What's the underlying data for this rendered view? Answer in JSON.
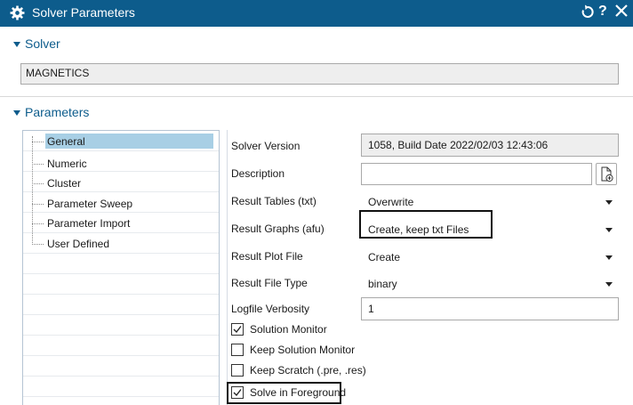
{
  "window": {
    "title": "Solver Parameters",
    "help_label": "?"
  },
  "sections": {
    "solver_heading": "Solver",
    "parameters_heading": "Parameters"
  },
  "solver": {
    "name": "MAGNETICS"
  },
  "tree": {
    "items": [
      {
        "label": "General",
        "selected": true
      },
      {
        "label": "Numeric"
      },
      {
        "label": "Cluster"
      },
      {
        "label": "Parameter Sweep"
      },
      {
        "label": "Parameter Import"
      },
      {
        "label": "User Defined"
      }
    ]
  },
  "general": {
    "solver_version": {
      "label": "Solver Version",
      "value": "1058, Build Date 2022/02/03 12:43:06"
    },
    "description": {
      "label": "Description",
      "value": ""
    },
    "result_tables": {
      "label": "Result Tables (txt)",
      "value": "Overwrite"
    },
    "result_graphs": {
      "label": "Result Graphs (afu)",
      "value": "Create, keep txt Files"
    },
    "result_plot_file": {
      "label": "Result Plot File",
      "value": "Create"
    },
    "result_file_type": {
      "label": "Result File Type",
      "value": "binary"
    },
    "logfile_verbosity": {
      "label": "Logfile Verbosity",
      "value": "1"
    },
    "checkboxes": [
      {
        "label": "Solution Monitor",
        "checked": true
      },
      {
        "label": "Keep Solution Monitor",
        "checked": false
      },
      {
        "label": "Keep Scratch (.pre, .res)",
        "checked": false
      },
      {
        "label": "Solve in Foreground",
        "checked": true
      }
    ]
  },
  "colors": {
    "title_bar": "#0d5c8c",
    "selection": "#a8cfe5",
    "field_readonly": "#eeeeee"
  }
}
